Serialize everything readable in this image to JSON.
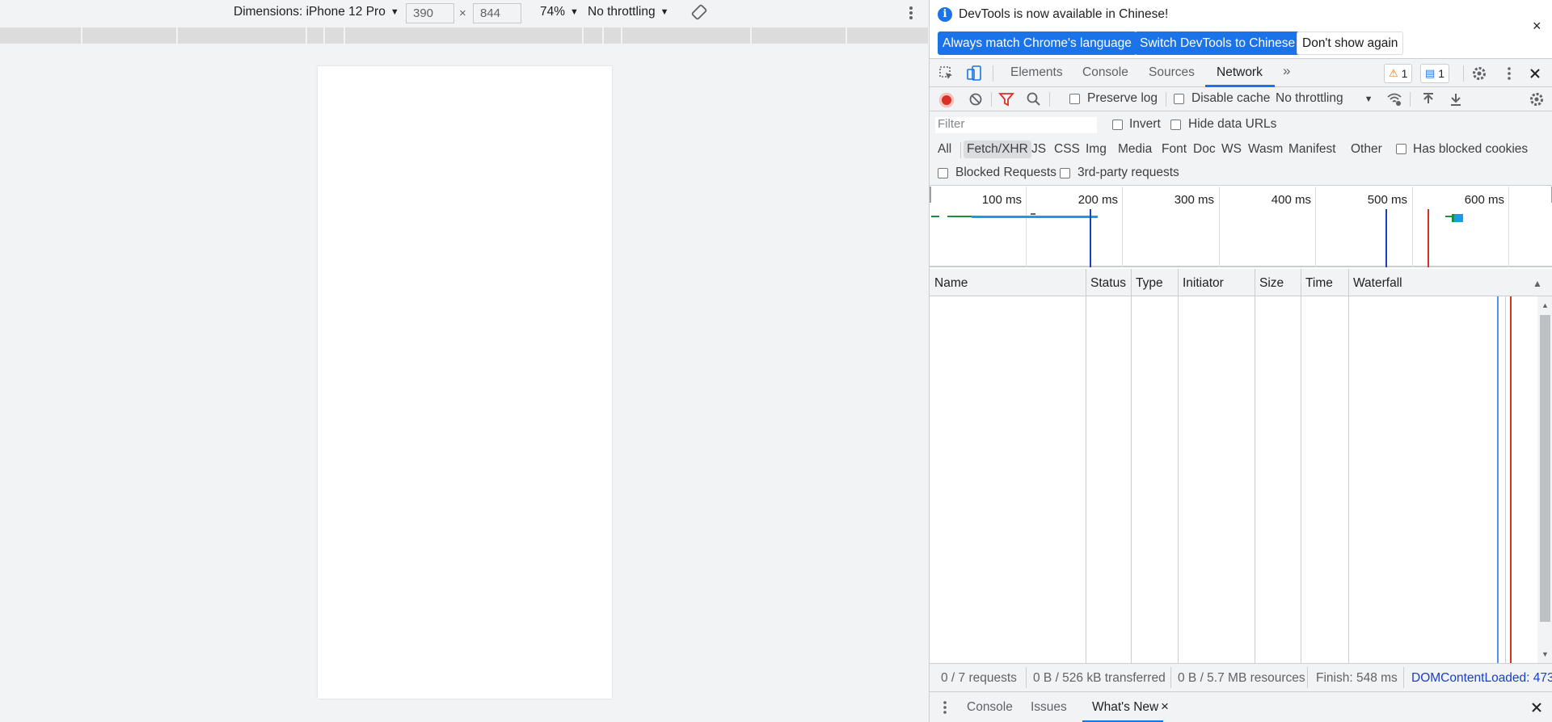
{
  "emulation": {
    "dimensions_label": "Dimensions: iPhone 12 Pro",
    "caret": "▼",
    "width_value": "390",
    "height_value": "844",
    "times": "×",
    "zoom": "74%",
    "throttling": "No throttling"
  },
  "infobar": {
    "icon": "i",
    "message": "DevTools is now available in Chinese!",
    "btn_always_match": "Always match Chrome's language",
    "btn_switch": "Switch DevTools to Chinese",
    "btn_dont_show": "Don't show again",
    "close": "×"
  },
  "tabs": {
    "items": [
      "Elements",
      "Console",
      "Sources",
      "Network"
    ],
    "active": "Network",
    "more": "»",
    "warnings_count": "1",
    "messages_count": "1"
  },
  "network_toolbar": {
    "preserve_log": "Preserve log",
    "disable_cache": "Disable cache",
    "throttling": "No throttling"
  },
  "filter": {
    "placeholder": "Filter",
    "invert": "Invert",
    "hide_data_urls": "Hide data URLs",
    "types": [
      "All",
      "Fetch/XHR",
      "JS",
      "CSS",
      "Img",
      "Media",
      "Font",
      "Doc",
      "WS",
      "Wasm",
      "Manifest",
      "Other"
    ],
    "active_type": "Fetch/XHR",
    "has_blocked_cookies": "Has blocked cookies",
    "blocked_requests": "Blocked Requests",
    "third_party": "3rd-party requests"
  },
  "overview": {
    "ticks": [
      "100 ms",
      "200 ms",
      "300 ms",
      "400 ms",
      "500 ms",
      "600 ms"
    ]
  },
  "table": {
    "columns": [
      "Name",
      "Status",
      "Type",
      "Initiator",
      "Size",
      "Time",
      "Waterfall"
    ],
    "sort_indicator": "▲"
  },
  "status": {
    "requests": "0 / 7 requests",
    "transferred": "0 B / 526 kB transferred",
    "resources": "0 B / 5.7 MB resources",
    "finish": "Finish: 548 ms",
    "dom_content_loaded": "DOMContentLoaded: 473"
  },
  "drawer": {
    "tabs": [
      "Console",
      "Issues",
      "What's New"
    ],
    "active": "What's New",
    "close": "×"
  },
  "colors": {
    "accent": "#1a73e8",
    "record": "#d93025",
    "dcl_line": "#1a3fc4",
    "load_line": "#d93025"
  }
}
